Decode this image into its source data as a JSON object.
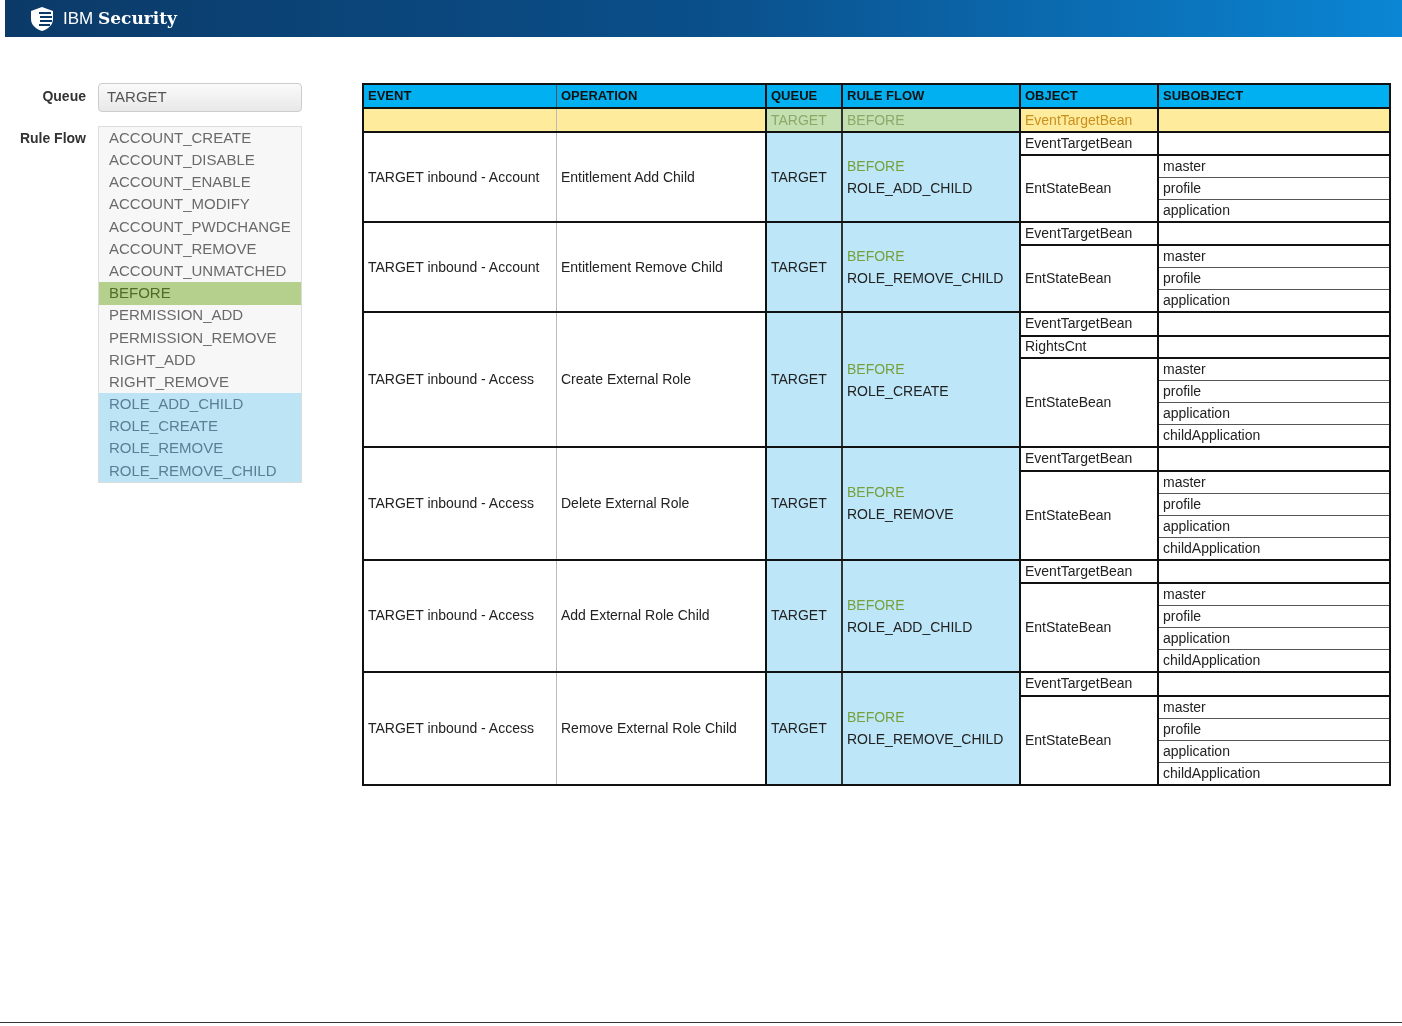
{
  "header": {
    "brand": "IBM",
    "product": "Security"
  },
  "form": {
    "queue": {
      "label": "Queue",
      "value": "TARGET"
    },
    "rule_flow": {
      "label": "Rule Flow",
      "items": [
        {
          "label": "ACCOUNT_CREATE",
          "kind": "plain"
        },
        {
          "label": "ACCOUNT_DISABLE",
          "kind": "plain"
        },
        {
          "label": "ACCOUNT_ENABLE",
          "kind": "plain"
        },
        {
          "label": "ACCOUNT_MODIFY",
          "kind": "plain"
        },
        {
          "label": "ACCOUNT_PWDCHANGE",
          "kind": "plain"
        },
        {
          "label": "ACCOUNT_REMOVE",
          "kind": "plain"
        },
        {
          "label": "ACCOUNT_UNMATCHED",
          "kind": "plain"
        },
        {
          "label": "BEFORE",
          "kind": "green"
        },
        {
          "label": "PERMISSION_ADD",
          "kind": "plain"
        },
        {
          "label": "PERMISSION_REMOVE",
          "kind": "plain"
        },
        {
          "label": "RIGHT_ADD",
          "kind": "plain"
        },
        {
          "label": "RIGHT_REMOVE",
          "kind": "plain"
        },
        {
          "label": "ROLE_ADD_CHILD",
          "kind": "blue"
        },
        {
          "label": "ROLE_CREATE",
          "kind": "blue"
        },
        {
          "label": "ROLE_REMOVE",
          "kind": "blue"
        },
        {
          "label": "ROLE_REMOVE_CHILD",
          "kind": "blue"
        }
      ]
    }
  },
  "table": {
    "columns": [
      "EVENT",
      "OPERATION",
      "QUEUE",
      "RULE FLOW",
      "OBJECT",
      "SUBOBJECT"
    ],
    "filter_row": {
      "queue": "TARGET",
      "rule_flow": "BEFORE",
      "object": "EventTargetBean"
    },
    "groups": [
      {
        "event": "TARGET inbound - Account",
        "operation": "Entitlement Add Child",
        "queue": "TARGET",
        "rule_flow": [
          {
            "text": "BEFORE",
            "kind": "phase"
          },
          {
            "text": "ROLE_ADD_CHILD",
            "kind": "flow"
          }
        ],
        "objects": [
          {
            "name": "EventTargetBean"
          },
          {
            "name": "EntStateBean",
            "subobjects": [
              "master",
              "profile",
              "application"
            ]
          }
        ]
      },
      {
        "event": "TARGET inbound - Account",
        "operation": "Entitlement Remove Child",
        "queue": "TARGET",
        "rule_flow": [
          {
            "text": "BEFORE",
            "kind": "phase"
          },
          {
            "text": "ROLE_REMOVE_CHILD",
            "kind": "flow"
          }
        ],
        "objects": [
          {
            "name": "EventTargetBean"
          },
          {
            "name": "EntStateBean",
            "subobjects": [
              "master",
              "profile",
              "application"
            ]
          }
        ]
      },
      {
        "event": "TARGET inbound - Access",
        "operation": "Create External Role",
        "queue": "TARGET",
        "rule_flow": [
          {
            "text": "BEFORE",
            "kind": "phase"
          },
          {
            "text": "ROLE_CREATE",
            "kind": "flow"
          }
        ],
        "objects": [
          {
            "name": "EventTargetBean"
          },
          {
            "name": "RightsCnt"
          },
          {
            "name": "EntStateBean",
            "subobjects": [
              "master",
              "profile",
              "application",
              "childApplication"
            ]
          }
        ]
      },
      {
        "event": "TARGET inbound - Access",
        "operation": "Delete External Role",
        "queue": "TARGET",
        "rule_flow": [
          {
            "text": "BEFORE",
            "kind": "phase"
          },
          {
            "text": "ROLE_REMOVE",
            "kind": "flow"
          }
        ],
        "objects": [
          {
            "name": "EventTargetBean"
          },
          {
            "name": "EntStateBean",
            "subobjects": [
              "master",
              "profile",
              "application",
              "childApplication"
            ]
          }
        ]
      },
      {
        "event": "TARGET inbound - Access",
        "operation": "Add External Role Child",
        "queue": "TARGET",
        "rule_flow": [
          {
            "text": "BEFORE",
            "kind": "phase"
          },
          {
            "text": "ROLE_ADD_CHILD",
            "kind": "flow"
          }
        ],
        "objects": [
          {
            "name": "EventTargetBean"
          },
          {
            "name": "EntStateBean",
            "subobjects": [
              "master",
              "profile",
              "application",
              "childApplication"
            ]
          }
        ]
      },
      {
        "event": "TARGET inbound - Access",
        "operation": "Remove External Role Child",
        "queue": "TARGET",
        "rule_flow": [
          {
            "text": "BEFORE",
            "kind": "phase"
          },
          {
            "text": "ROLE_REMOVE_CHILD",
            "kind": "flow"
          }
        ],
        "objects": [
          {
            "name": "EventTargetBean"
          },
          {
            "name": "EntStateBean",
            "subobjects": [
              "master",
              "profile",
              "application",
              "childApplication"
            ]
          }
        ]
      }
    ]
  }
}
